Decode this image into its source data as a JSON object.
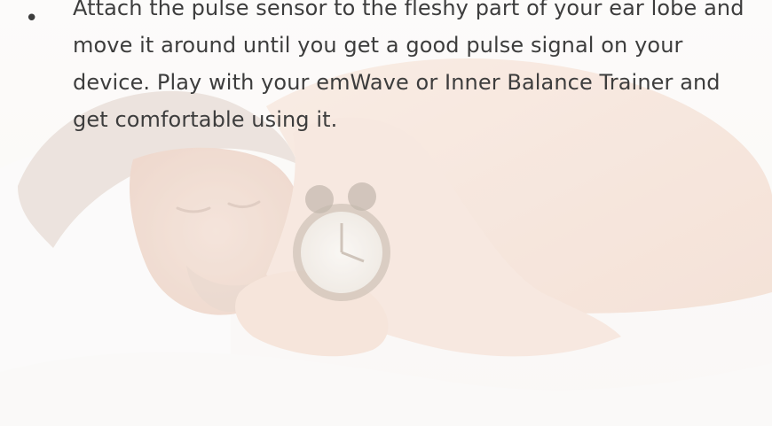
{
  "slide": {
    "bullet_symbol": "•",
    "bullet_text": "Attach the pulse sensor to the fleshy part of your ear lobe and move it around until you get a good pulse signal on your device. Play with your emWave or Inner Balance Trainer and get comfortable using it.",
    "background_image": "man-sleeping-with-alarm-clock"
  },
  "colors": {
    "text": "#3d3d3d",
    "background": "#ffffff"
  }
}
